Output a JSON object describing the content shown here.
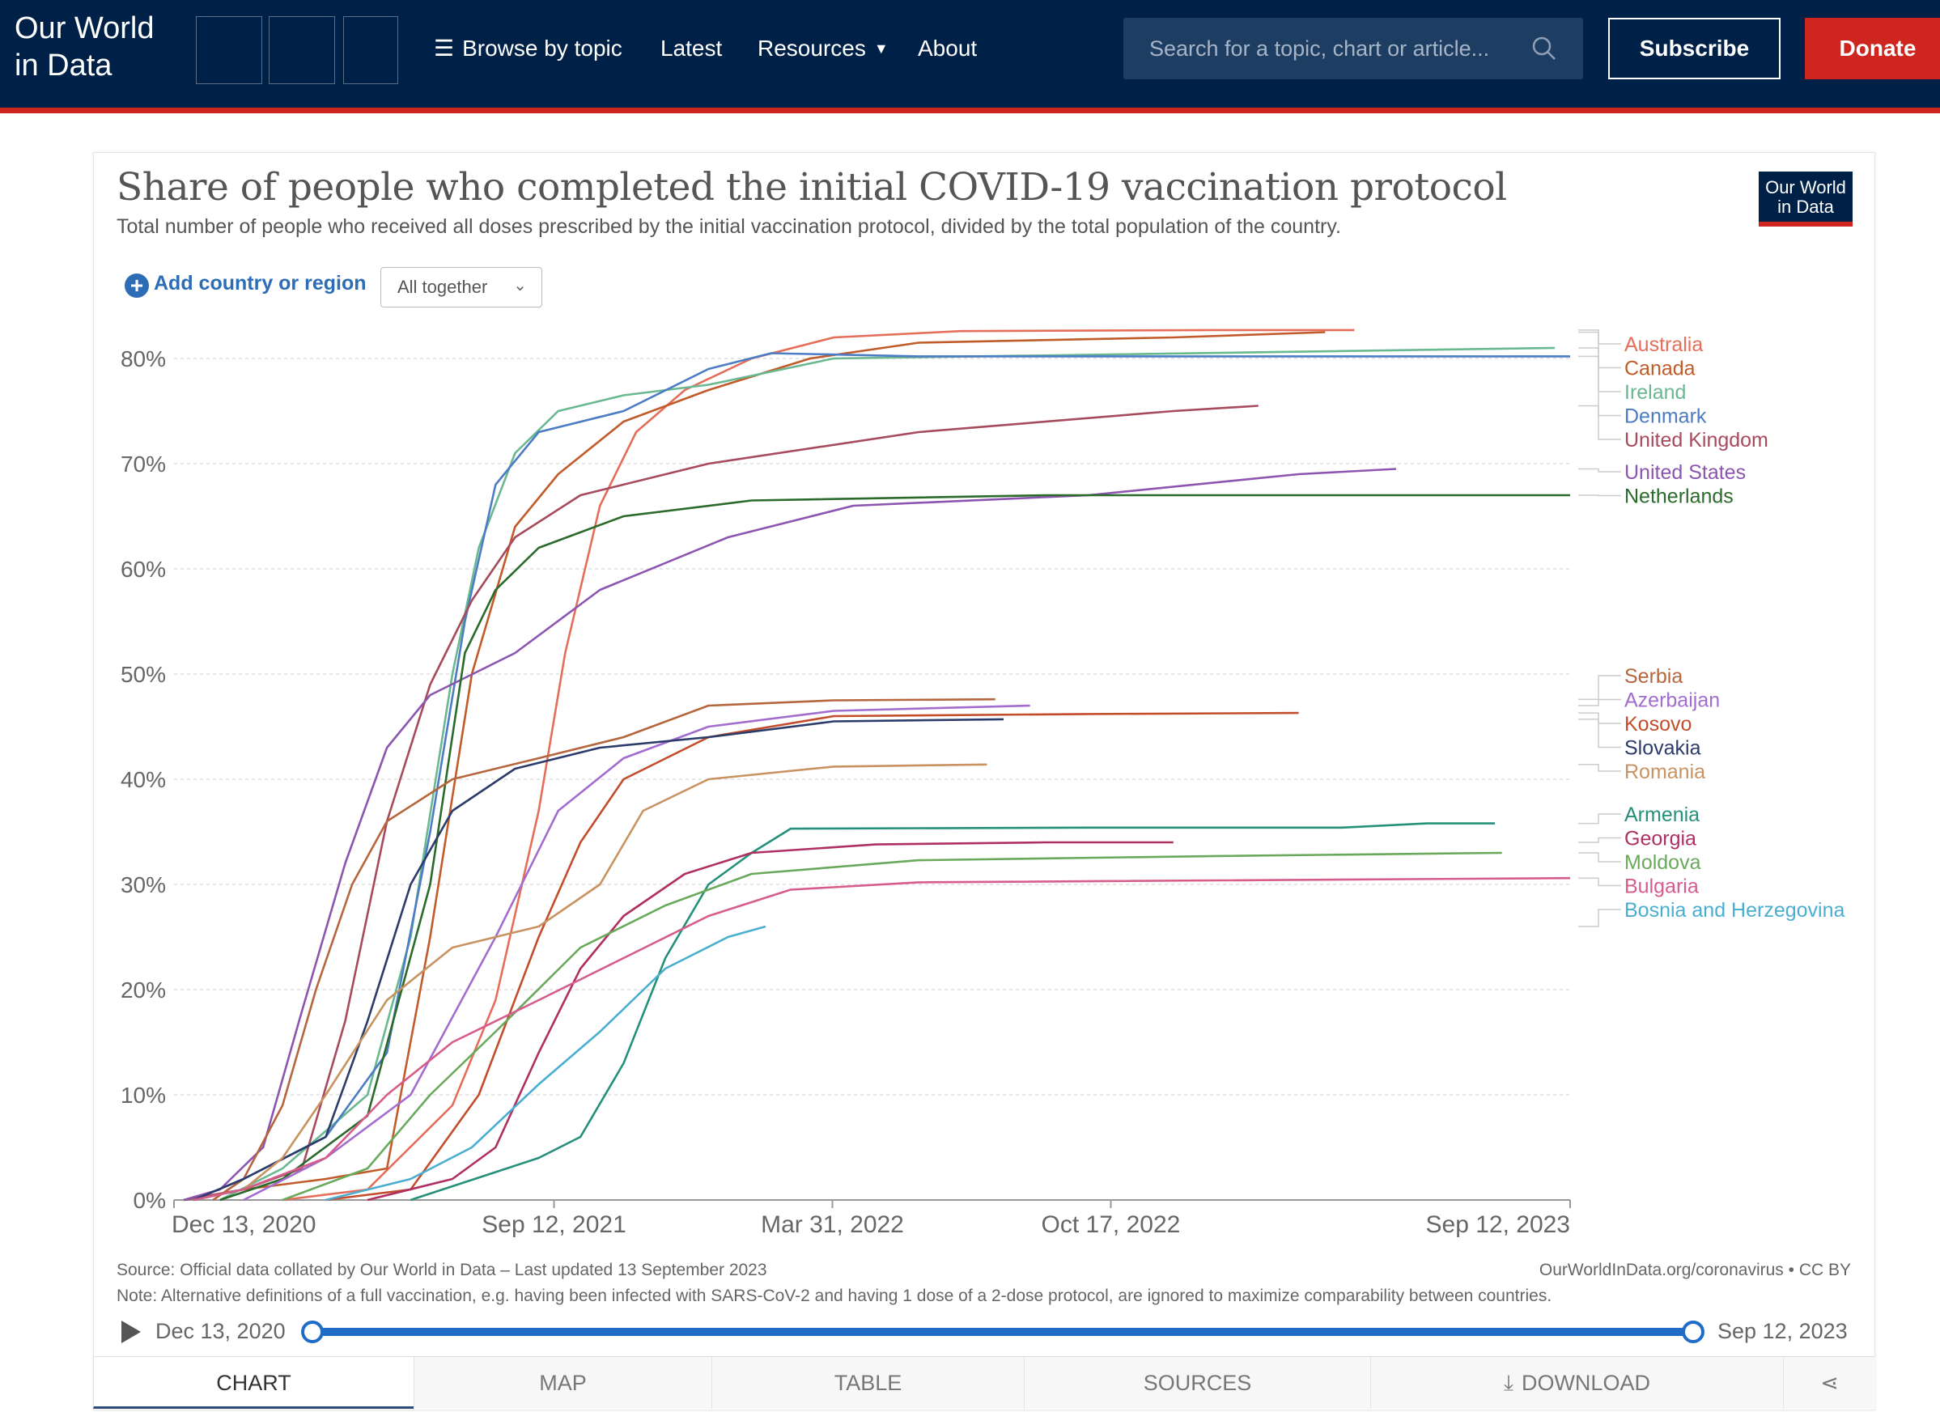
{
  "header": {
    "logo": "Our World in Data",
    "logo_line1": "Our World",
    "logo_line2": "in Data",
    "nav": {
      "browse": "Browse by topic",
      "latest": "Latest",
      "resources": "Resources",
      "about": "About"
    },
    "search_placeholder": "Search for a topic, chart or article...",
    "subscribe": "Subscribe",
    "donate": "Donate"
  },
  "chart_header": {
    "title": "Share of people who completed the initial COVID-19 vaccination protocol",
    "subtitle": "Total number of people who received all doses prescribed by the initial vaccination protocol, divided by the total population of the country.",
    "badge_line1": "Our World",
    "badge_line2": "in Data"
  },
  "controls": {
    "add_country": "Add country or region",
    "facet_select": "All together"
  },
  "footer": {
    "source": "Source: Official data collated by Our World in Data – Last updated 13 September 2023",
    "license": "OurWorldInData.org/coronavirus • CC BY",
    "note": "Note: Alternative definitions of a full vaccination, e.g. having been infected with SARS-CoV-2 and having 1 dose of a 2-dose protocol, are ignored to maximize comparability between countries."
  },
  "timeline": {
    "start": "Dec 13, 2020",
    "end": "Sep 12, 2023"
  },
  "tabs": {
    "chart": "CHART",
    "map": "MAP",
    "table": "TABLE",
    "sources": "SOURCES",
    "download": "DOWNLOAD"
  },
  "chart_data": {
    "type": "line",
    "title": "Share of people who completed the initial COVID-19 vaccination protocol",
    "subtitle": "Total number of people who received all doses prescribed by the initial vaccination protocol, divided by the total population of the country.",
    "y_unit": "%",
    "ylim": [
      0,
      83
    ],
    "y_ticks": [
      0,
      10,
      20,
      30,
      40,
      50,
      60,
      70,
      80
    ],
    "y_tick_labels": [
      "0%",
      "10%",
      "20%",
      "30%",
      "40%",
      "50%",
      "60%",
      "70%",
      "80%"
    ],
    "xlim": [
      "2020-12-13",
      "2023-09-12"
    ],
    "x_ticks": [
      "2020-12-13",
      "2021-09-12",
      "2022-03-31",
      "2022-10-17",
      "2023-09-12"
    ],
    "x_tick_labels": [
      "Dec 13, 2020",
      "Sep 12, 2021",
      "Mar 31, 2022",
      "Oct 17, 2022",
      "Sep 12, 2023"
    ],
    "grid": "horizontal-dashed",
    "legend": "right",
    "series": [
      {
        "name": "Australia",
        "color": "#e56e5a",
        "points": [
          [
            "2021-03-01",
            0
          ],
          [
            "2021-05-01",
            1
          ],
          [
            "2021-07-01",
            9
          ],
          [
            "2021-08-01",
            19
          ],
          [
            "2021-09-01",
            37
          ],
          [
            "2021-09-20",
            52
          ],
          [
            "2021-10-15",
            66
          ],
          [
            "2021-11-10",
            73
          ],
          [
            "2021-12-15",
            77
          ],
          [
            "2022-02-01",
            80
          ],
          [
            "2022-04-01",
            82
          ],
          [
            "2022-07-01",
            82.6
          ],
          [
            "2023-01-01",
            82.7
          ],
          [
            "2023-04-10",
            82.7
          ]
        ]
      },
      {
        "name": "Canada",
        "color": "#c15b2a",
        "points": [
          [
            "2020-12-20",
            0
          ],
          [
            "2021-02-01",
            1
          ],
          [
            "2021-04-01",
            2
          ],
          [
            "2021-05-15",
            3
          ],
          [
            "2021-06-15",
            25
          ],
          [
            "2021-07-15",
            50
          ],
          [
            "2021-08-15",
            64
          ],
          [
            "2021-09-15",
            69
          ],
          [
            "2021-11-01",
            74
          ],
          [
            "2022-01-01",
            77
          ],
          [
            "2022-03-15",
            80
          ],
          [
            "2022-06-01",
            81.5
          ],
          [
            "2022-12-01",
            82
          ],
          [
            "2023-03-20",
            82.5
          ]
        ]
      },
      {
        "name": "Ireland",
        "color": "#6ab890",
        "points": [
          [
            "2021-01-15",
            0
          ],
          [
            "2021-03-01",
            3
          ],
          [
            "2021-05-01",
            10
          ],
          [
            "2021-06-01",
            25
          ],
          [
            "2021-07-01",
            50
          ],
          [
            "2021-07-20",
            62
          ],
          [
            "2021-08-15",
            71
          ],
          [
            "2021-09-15",
            75
          ],
          [
            "2021-11-01",
            76.5
          ],
          [
            "2022-01-01",
            77.5
          ],
          [
            "2022-04-01",
            80
          ],
          [
            "2023-09-01",
            81
          ]
        ]
      },
      {
        "name": "Denmark",
        "color": "#4c7cc4",
        "points": [
          [
            "2020-12-27",
            0
          ],
          [
            "2021-02-01",
            2
          ],
          [
            "2021-04-01",
            6
          ],
          [
            "2021-05-15",
            14
          ],
          [
            "2021-06-15",
            35
          ],
          [
            "2021-07-10",
            55
          ],
          [
            "2021-08-01",
            68
          ],
          [
            "2021-09-01",
            73
          ],
          [
            "2021-11-01",
            75
          ],
          [
            "2022-01-01",
            79
          ],
          [
            "2022-02-15",
            80.5
          ],
          [
            "2022-06-01",
            80.2
          ],
          [
            "2023-09-12",
            80.2
          ]
        ]
      },
      {
        "name": "United Kingdom",
        "color": "#a64a5c",
        "points": [
          [
            "2020-12-20",
            0
          ],
          [
            "2021-02-01",
            1
          ],
          [
            "2021-03-15",
            3
          ],
          [
            "2021-04-15",
            17
          ],
          [
            "2021-05-15",
            36
          ],
          [
            "2021-06-15",
            49
          ],
          [
            "2021-07-15",
            57
          ],
          [
            "2021-08-15",
            63
          ],
          [
            "2021-10-01",
            67
          ],
          [
            "2022-01-01",
            70
          ],
          [
            "2022-06-01",
            73
          ],
          [
            "2022-12-01",
            75
          ],
          [
            "2023-01-31",
            75.5
          ]
        ]
      },
      {
        "name": "United States",
        "color": "#8b55b0",
        "points": [
          [
            "2020-12-20",
            0
          ],
          [
            "2021-01-15",
            1
          ],
          [
            "2021-02-15",
            5
          ],
          [
            "2021-03-15",
            18
          ],
          [
            "2021-04-15",
            32
          ],
          [
            "2021-05-15",
            43
          ],
          [
            "2021-06-15",
            48
          ],
          [
            "2021-08-15",
            52
          ],
          [
            "2021-10-15",
            58
          ],
          [
            "2022-01-15",
            63
          ],
          [
            "2022-04-15",
            66
          ],
          [
            "2022-10-01",
            67
          ],
          [
            "2023-03-01",
            69
          ],
          [
            "2023-05-10",
            69.5
          ]
        ]
      },
      {
        "name": "Netherlands",
        "color": "#2a6a2a",
        "points": [
          [
            "2021-01-15",
            0
          ],
          [
            "2021-03-01",
            2
          ],
          [
            "2021-05-01",
            8
          ],
          [
            "2021-06-15",
            30
          ],
          [
            "2021-07-10",
            52
          ],
          [
            "2021-08-01",
            58
          ],
          [
            "2021-09-01",
            62
          ],
          [
            "2021-11-01",
            65
          ],
          [
            "2022-02-01",
            66.5
          ],
          [
            "2022-09-01",
            67
          ],
          [
            "2023-09-12",
            67
          ]
        ]
      },
      {
        "name": "Serbia",
        "color": "#b5663d",
        "points": [
          [
            "2021-01-10",
            0
          ],
          [
            "2021-02-01",
            2
          ],
          [
            "2021-03-01",
            9
          ],
          [
            "2021-03-25",
            20
          ],
          [
            "2021-04-20",
            30
          ],
          [
            "2021-05-15",
            36
          ],
          [
            "2021-07-01",
            40
          ],
          [
            "2021-09-01",
            42
          ],
          [
            "2021-11-01",
            44
          ],
          [
            "2022-01-01",
            47
          ],
          [
            "2022-04-01",
            47.5
          ],
          [
            "2022-07-26",
            47.6
          ]
        ]
      },
      {
        "name": "Azerbaijan",
        "color": "#a26dce",
        "points": [
          [
            "2021-02-01",
            0
          ],
          [
            "2021-04-01",
            4
          ],
          [
            "2021-06-01",
            10
          ],
          [
            "2021-08-01",
            25
          ],
          [
            "2021-09-15",
            37
          ],
          [
            "2021-11-01",
            42
          ],
          [
            "2022-01-01",
            45
          ],
          [
            "2022-04-01",
            46.5
          ],
          [
            "2022-08-20",
            47
          ]
        ]
      },
      {
        "name": "Kosovo",
        "color": "#c34d2a",
        "points": [
          [
            "2021-04-01",
            0
          ],
          [
            "2021-06-01",
            1
          ],
          [
            "2021-07-20",
            10
          ],
          [
            "2021-09-01",
            25
          ],
          [
            "2021-10-01",
            34
          ],
          [
            "2021-11-01",
            40
          ],
          [
            "2022-01-01",
            44
          ],
          [
            "2022-04-01",
            46
          ],
          [
            "2022-10-01",
            46.2
          ],
          [
            "2023-03-01",
            46.3
          ]
        ]
      },
      {
        "name": "Slovakia",
        "color": "#2b3b6a",
        "points": [
          [
            "2020-12-27",
            0
          ],
          [
            "2021-02-01",
            2
          ],
          [
            "2021-04-01",
            6
          ],
          [
            "2021-05-01",
            17
          ],
          [
            "2021-06-01",
            30
          ],
          [
            "2021-07-01",
            37
          ],
          [
            "2021-08-15",
            41
          ],
          [
            "2021-10-15",
            43
          ],
          [
            "2022-01-01",
            44
          ],
          [
            "2022-04-01",
            45.5
          ],
          [
            "2022-08-01",
            45.7
          ]
        ]
      },
      {
        "name": "Romania",
        "color": "#c89360",
        "points": [
          [
            "2020-12-27",
            0
          ],
          [
            "2021-02-01",
            1
          ],
          [
            "2021-03-01",
            4
          ],
          [
            "2021-04-01",
            10
          ],
          [
            "2021-05-15",
            19
          ],
          [
            "2021-07-01",
            24
          ],
          [
            "2021-09-01",
            26
          ],
          [
            "2021-10-15",
            30
          ],
          [
            "2021-11-15",
            37
          ],
          [
            "2022-01-01",
            40
          ],
          [
            "2022-04-01",
            41.2
          ],
          [
            "2022-07-20",
            41.4
          ]
        ]
      },
      {
        "name": "Armenia",
        "color": "#25907a",
        "points": [
          [
            "2021-06-01",
            0
          ],
          [
            "2021-09-01",
            4
          ],
          [
            "2021-10-01",
            6
          ],
          [
            "2021-11-01",
            13
          ],
          [
            "2021-12-01",
            23
          ],
          [
            "2022-01-01",
            30
          ],
          [
            "2022-02-01",
            33
          ],
          [
            "2022-03-01",
            35.3
          ],
          [
            "2022-10-01",
            35.4
          ],
          [
            "2023-04-01",
            35.4
          ],
          [
            "2023-06-01",
            35.8
          ],
          [
            "2023-07-20",
            35.8
          ]
        ]
      },
      {
        "name": "Georgia",
        "color": "#b02f62",
        "points": [
          [
            "2021-05-01",
            0
          ],
          [
            "2021-07-01",
            2
          ],
          [
            "2021-08-01",
            5
          ],
          [
            "2021-09-01",
            14
          ],
          [
            "2021-10-01",
            22
          ],
          [
            "2021-11-01",
            27
          ],
          [
            "2021-12-15",
            31
          ],
          [
            "2022-02-01",
            33
          ],
          [
            "2022-05-01",
            33.8
          ],
          [
            "2022-09-01",
            34
          ],
          [
            "2022-12-01",
            34
          ]
        ]
      },
      {
        "name": "Moldova",
        "color": "#6aa95c",
        "points": [
          [
            "2021-03-01",
            0
          ],
          [
            "2021-05-01",
            3
          ],
          [
            "2021-06-15",
            10
          ],
          [
            "2021-08-01",
            16
          ],
          [
            "2021-10-01",
            24
          ],
          [
            "2021-12-01",
            28
          ],
          [
            "2022-02-01",
            31
          ],
          [
            "2022-06-01",
            32.3
          ],
          [
            "2023-01-01",
            32.7
          ],
          [
            "2023-07-25",
            33
          ]
        ]
      },
      {
        "name": "Bulgaria",
        "color": "#d65c8c",
        "points": [
          [
            "2020-12-27",
            0
          ],
          [
            "2021-02-01",
            1
          ],
          [
            "2021-04-01",
            4
          ],
          [
            "2021-05-15",
            10
          ],
          [
            "2021-07-01",
            15
          ],
          [
            "2021-09-01",
            19
          ],
          [
            "2021-11-01",
            23
          ],
          [
            "2022-01-01",
            27
          ],
          [
            "2022-03-01",
            29.5
          ],
          [
            "2022-06-01",
            30.2
          ],
          [
            "2023-09-12",
            30.6
          ]
        ]
      },
      {
        "name": "Bosnia and Herzegovina",
        "color": "#4aaed0",
        "points": [
          [
            "2021-04-01",
            0
          ],
          [
            "2021-06-01",
            2
          ],
          [
            "2021-07-15",
            5
          ],
          [
            "2021-09-01",
            11
          ],
          [
            "2021-10-15",
            16
          ],
          [
            "2021-12-01",
            22
          ],
          [
            "2022-01-15",
            25
          ],
          [
            "2022-02-11",
            26
          ]
        ]
      }
    ],
    "legend_groups": [
      [
        "Australia",
        "Canada",
        "Ireland",
        "Denmark",
        "United Kingdom"
      ],
      [
        "United States",
        "Netherlands"
      ],
      [
        "Serbia",
        "Azerbaijan",
        "Kosovo",
        "Slovakia",
        "Romania"
      ],
      [
        "Armenia",
        "Georgia",
        "Moldova",
        "Bulgaria",
        "Bosnia and Herzegovina"
      ]
    ]
  }
}
